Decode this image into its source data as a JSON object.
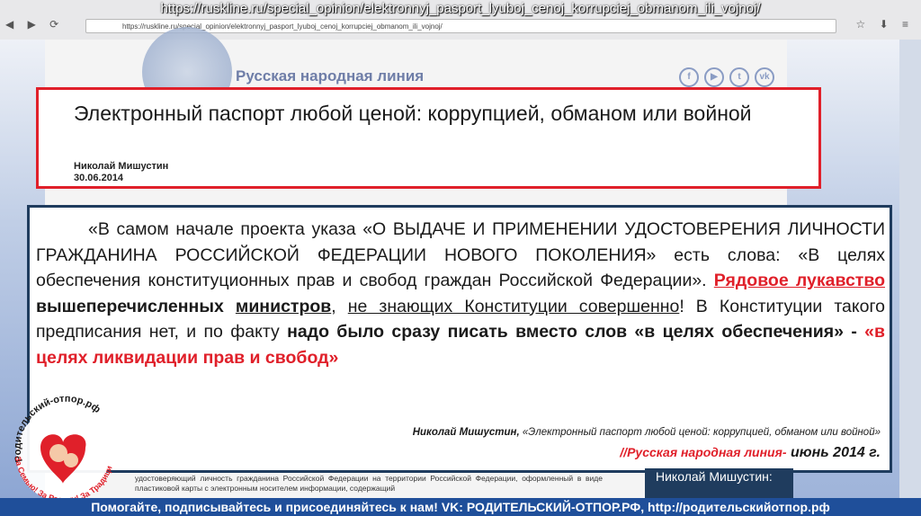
{
  "browser": {
    "url_banner": "https://ruskline.ru/special_opinion/elektronnyj_pasport_lyuboj_cenoj_korrupciej_obmanom_ili_vojnoj/",
    "address": "https://ruskline.ru/special_opinion/elektronnyj_pasport_lyuboj_cenoj_korrupciej_obmanom_ili_vojnoj/"
  },
  "site": {
    "name": "Русская народная линия",
    "social_icons": [
      "facebook-icon",
      "youtube-icon",
      "twitter-icon",
      "vk-icon"
    ]
  },
  "article": {
    "title": "Электронный паспорт любой ценой: коррупцией, обманом или войной",
    "author": "Николай Мишустин",
    "date": "30.06.2014"
  },
  "quote": {
    "p1": "«В самом начале проекта указа «О ВЫДАЧЕ И ПРИМЕНЕНИИ УДОСТОВЕРЕНИЯ ЛИЧНОСТИ ГРАЖДАНИНА РОССИЙСКОЙ ФЕДЕРАЦИИ НОВОГО ПОКОЛЕНИЯ» есть слова: «В целях обеспечения конституционных прав и свобод граждан Российской Федерации». ",
    "red1": "Рядовое лукавство ",
    "b1": "вышеперечисленных",
    "sp1": " ",
    "b2": "министров",
    "t1": ", ",
    "u1": "не знающих Конституции совершенно",
    "t2": "! В Конституции такого предписания нет, и по факту ",
    "b3": "надо было сразу писать вместо слов «в целях обеспечения» - ",
    "red2": "«в целях ликвидации прав и свобод»"
  },
  "citation": {
    "author": "Николай Мишустин,",
    "work": " «Электронный паспорт любой ценой: коррупцией, обманом или войной»",
    "source": "//Русская народная линия-",
    "date": " июнь 2014 г."
  },
  "logo": {
    "top_text": "Родительский-отпор.рф",
    "bottom_text": "За Семью! За Родину! За Традиции!"
  },
  "under": {
    "text": "удостоверяющий личность гражданина Российской Федерации на территории Российской Федерации, оформленный в виде пластиковой карты с электронным носителем информации, содержащий",
    "right": "Николай Мишустин:"
  },
  "bottom_banner": "Помогайте, подписывайтесь и присоединяйтесь к нам! VK: РОДИТЕЛЬСКИЙ-ОТПОР.РФ, http://родительскийотпор.рф"
}
